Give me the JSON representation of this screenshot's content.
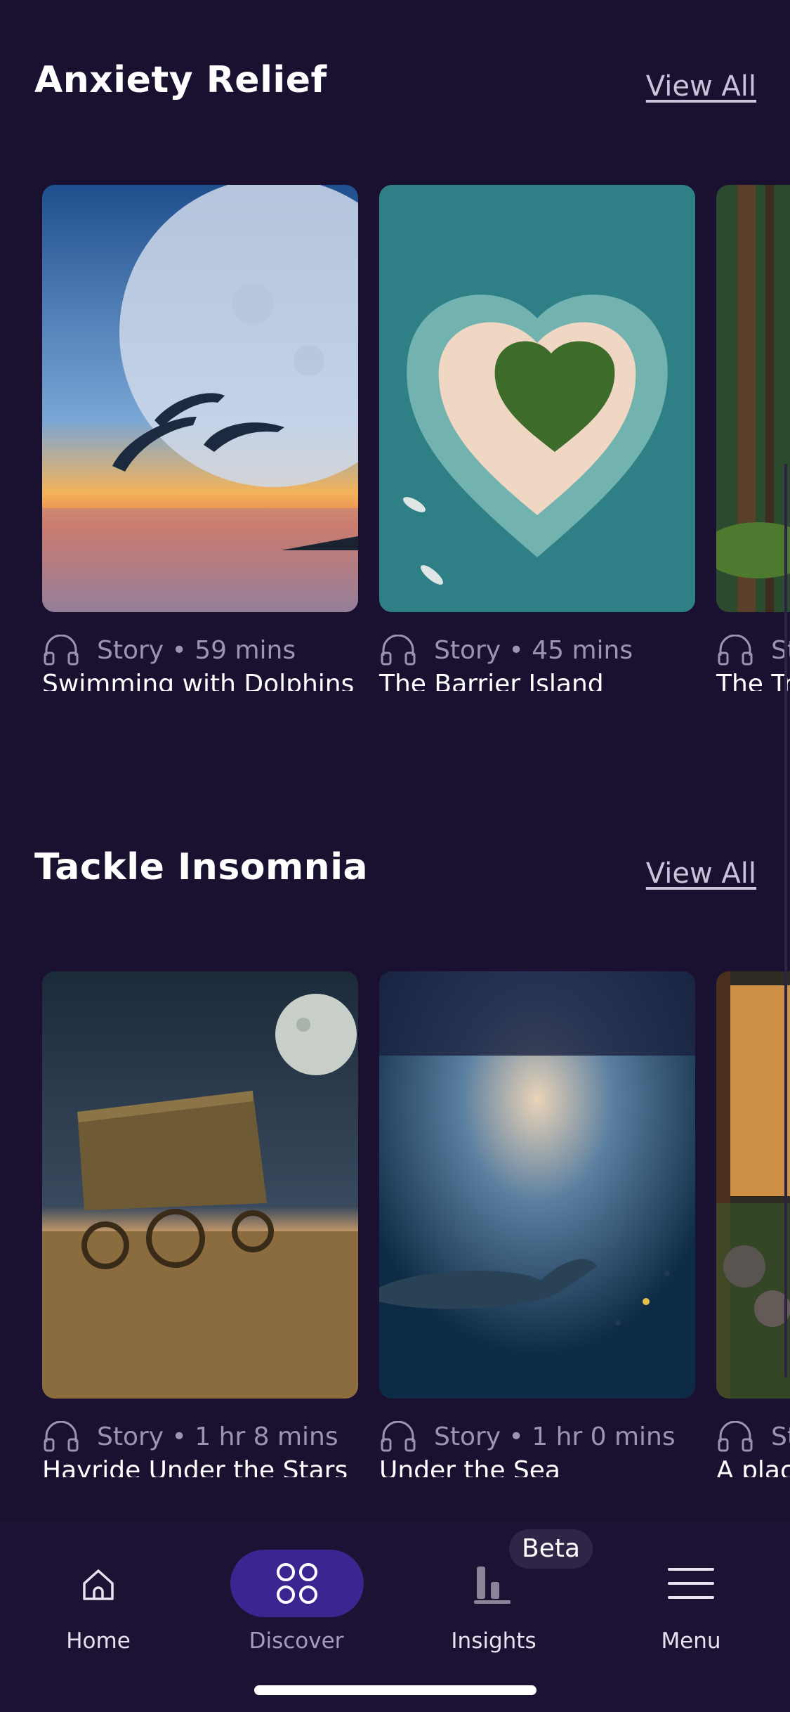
{
  "sections": [
    {
      "title": "Anxiety Relief",
      "view_all": "View All",
      "cards": [
        {
          "kind": "Story • 59 mins",
          "title": "Swimming with Dolphins"
        },
        {
          "kind": "Story • 45 mins",
          "title": "The Barrier Island"
        },
        {
          "kind": "St",
          "title": "The Tr"
        }
      ]
    },
    {
      "title": "Tackle Insomnia",
      "view_all": "View All",
      "cards": [
        {
          "kind": "Story • 1 hr 8 mins",
          "title": "Hayride Under the Stars"
        },
        {
          "kind": "Story • 1 hr 0 mins",
          "title": "Under the Sea"
        },
        {
          "kind": "St",
          "title": "A plac"
        }
      ]
    }
  ],
  "nav": {
    "items": [
      {
        "label": "Home",
        "icon": "home-icon"
      },
      {
        "label": "Discover",
        "icon": "discover-icon",
        "active": true
      },
      {
        "label": "Insights",
        "icon": "insights-icon"
      },
      {
        "label": "Menu",
        "icon": "menu-icon"
      }
    ],
    "beta_badge": "Beta"
  },
  "colors": {
    "background": "#1a1030",
    "accent": "#3b2590",
    "muted_text": "#9b94b2"
  }
}
